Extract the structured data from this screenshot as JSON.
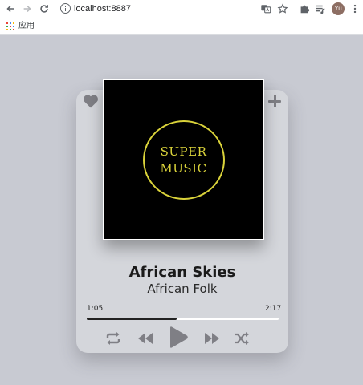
{
  "browser": {
    "url": "localhost:8887",
    "avatar_initials": "Yu",
    "bookmark_apps_label": "应用"
  },
  "player": {
    "title": "African Skies",
    "artist": "African Folk",
    "cover": {
      "line1": "SUPER",
      "line2": "MUSIC",
      "ring_color": "#d9d23a"
    },
    "current_time": "1:05",
    "total_time": "2:17",
    "progress": 0.47,
    "icons": [
      "heart-icon",
      "plus-icon",
      "repeat-icon",
      "previous-icon",
      "play-icon",
      "next-icon",
      "shuffle-icon"
    ]
  }
}
